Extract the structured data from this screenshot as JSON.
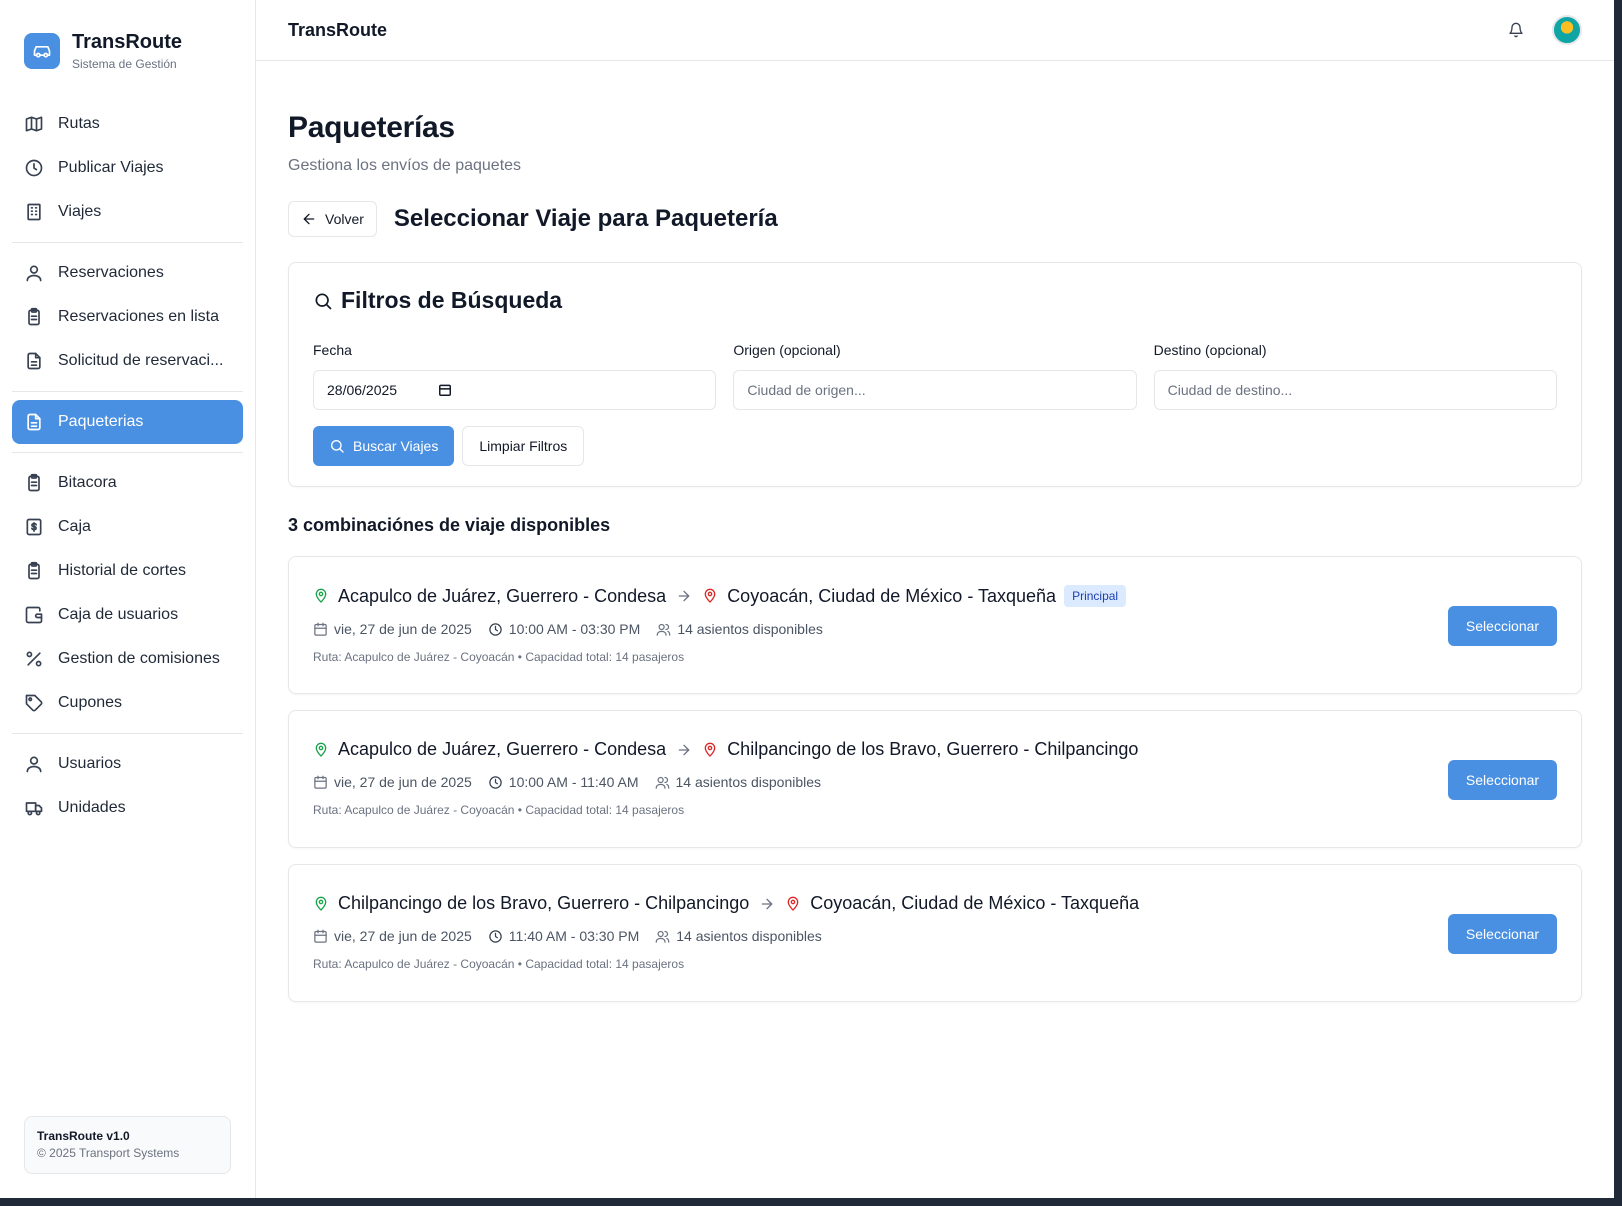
{
  "brand": {
    "name": "TransRoute",
    "subtitle": "Sistema de Gestión"
  },
  "sidebar": {
    "groups": [
      [
        {
          "label": "Rutas",
          "icon": "map-icon"
        },
        {
          "label": "Publicar Viajes",
          "icon": "clock-icon"
        },
        {
          "label": "Viajes",
          "icon": "building-icon"
        }
      ],
      [
        {
          "label": "Reservaciones",
          "icon": "user-icon"
        },
        {
          "label": "Reservaciones en lista",
          "icon": "clipboard-icon"
        },
        {
          "label": "Solicitud de reservaci...",
          "icon": "file-text-icon"
        }
      ],
      [
        {
          "label": "Paqueterias",
          "icon": "file-text-icon",
          "active": true
        }
      ],
      [
        {
          "label": "Bitacora",
          "icon": "clipboard-icon"
        },
        {
          "label": "Caja",
          "icon": "dollar-icon"
        },
        {
          "label": "Historial de cortes",
          "icon": "clipboard-icon"
        },
        {
          "label": "Caja de usuarios",
          "icon": "wallet-icon"
        },
        {
          "label": "Gestion de comisiones",
          "icon": "percent-icon"
        },
        {
          "label": "Cupones",
          "icon": "tag-icon"
        }
      ],
      [
        {
          "label": "Usuarios",
          "icon": "user-icon"
        },
        {
          "label": "Unidades",
          "icon": "truck-icon"
        }
      ]
    ],
    "version": "TransRoute v1.0",
    "copyright": "© 2025 Transport Systems"
  },
  "header": {
    "title": "TransRoute"
  },
  "page": {
    "title": "Paqueterías",
    "subtitle": "Gestiona los envíos de paquetes",
    "back_label": "Volver",
    "section_title": "Seleccionar Viaje para Paquetería"
  },
  "filters": {
    "title": "Filtros de Búsqueda",
    "date_label": "Fecha",
    "date_value": "28/06/2025",
    "origin_label": "Origen (opcional)",
    "origin_placeholder": "Ciudad de origen...",
    "dest_label": "Destino (opcional)",
    "dest_placeholder": "Ciudad de destino...",
    "search_label": "Buscar Viajes",
    "clear_label": "Limpiar Filtros"
  },
  "results": {
    "count_title": "3 combinaciónes de viaje disponibles",
    "select_label": "Seleccionar",
    "trips": [
      {
        "origin": "Acapulco de Juárez, Guerrero - Condesa",
        "destination": "Coyoacán, Ciudad de México - Taxqueña",
        "badge": "Principal",
        "date": "vie, 27 de jun de 2025",
        "time": "10:00 AM - 03:30 PM",
        "seats": "14 asientos disponibles",
        "note": "Ruta: Acapulco de Juárez - Coyoacán • Capacidad total: 14 pasajeros"
      },
      {
        "origin": "Acapulco de Juárez, Guerrero - Condesa",
        "destination": "Chilpancingo de los Bravo, Guerrero - Chilpancingo",
        "badge": "",
        "date": "vie, 27 de jun de 2025",
        "time": "10:00 AM - 11:40 AM",
        "seats": "14 asientos disponibles",
        "note": "Ruta: Acapulco de Juárez - Coyoacán • Capacidad total: 14 pasajeros"
      },
      {
        "origin": "Chilpancingo de los Bravo, Guerrero - Chilpancingo",
        "destination": "Coyoacán, Ciudad de México - Taxqueña",
        "badge": "",
        "date": "vie, 27 de jun de 2025",
        "time": "11:40 AM - 03:30 PM",
        "seats": "14 asientos disponibles",
        "note": "Ruta: Acapulco de Juárez - Coyoacán • Capacidad total: 14 pasajeros"
      }
    ]
  },
  "colors": {
    "accent": "#4a90e2",
    "origin_pin": "#16a34a",
    "destination_pin": "#dc2626"
  }
}
